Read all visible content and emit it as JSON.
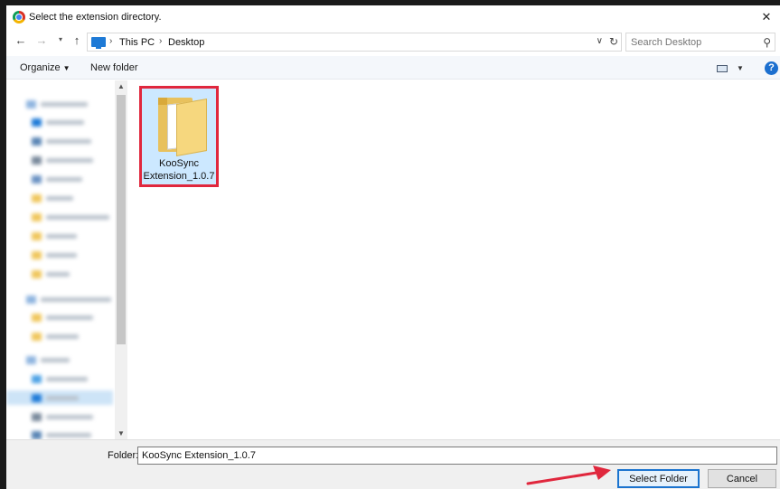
{
  "window": {
    "title": "Select the extension directory.",
    "close_glyph": "✕"
  },
  "address": {
    "back_glyph": "←",
    "forward_glyph": "→",
    "recent_glyph": "▾",
    "up_glyph": "↑",
    "breadcrumbs": [
      "This PC",
      "Desktop"
    ],
    "separator": "›",
    "dropdown_glyph": "∨",
    "refresh_glyph": "↻"
  },
  "search": {
    "placeholder": "Search Desktop",
    "icon": "search-icon",
    "glyph": "⚲"
  },
  "toolbar": {
    "organize_label": "Organize",
    "organize_caret": "▼",
    "new_folder_label": "New folder",
    "view_caret": "▼",
    "help_glyph": "?"
  },
  "scrollbar": {
    "up_glyph": "▲",
    "down_glyph": "▼"
  },
  "files": [
    {
      "name": "KooSync Extension_1.0.7",
      "name_line1": "KooSync",
      "name_line2": "Extension_1.0.7",
      "icon": "folder-icon",
      "selected": true
    }
  ],
  "footer": {
    "folder_label": "Folder:",
    "folder_value": "KooSync Extension_1.0.7",
    "select_button": "Select Folder",
    "cancel_button": "Cancel"
  },
  "colors": {
    "selection": "#cce8ff",
    "highlight_border": "#e0273d",
    "accent": "#1b74cf",
    "arrow": "#e0273d"
  }
}
